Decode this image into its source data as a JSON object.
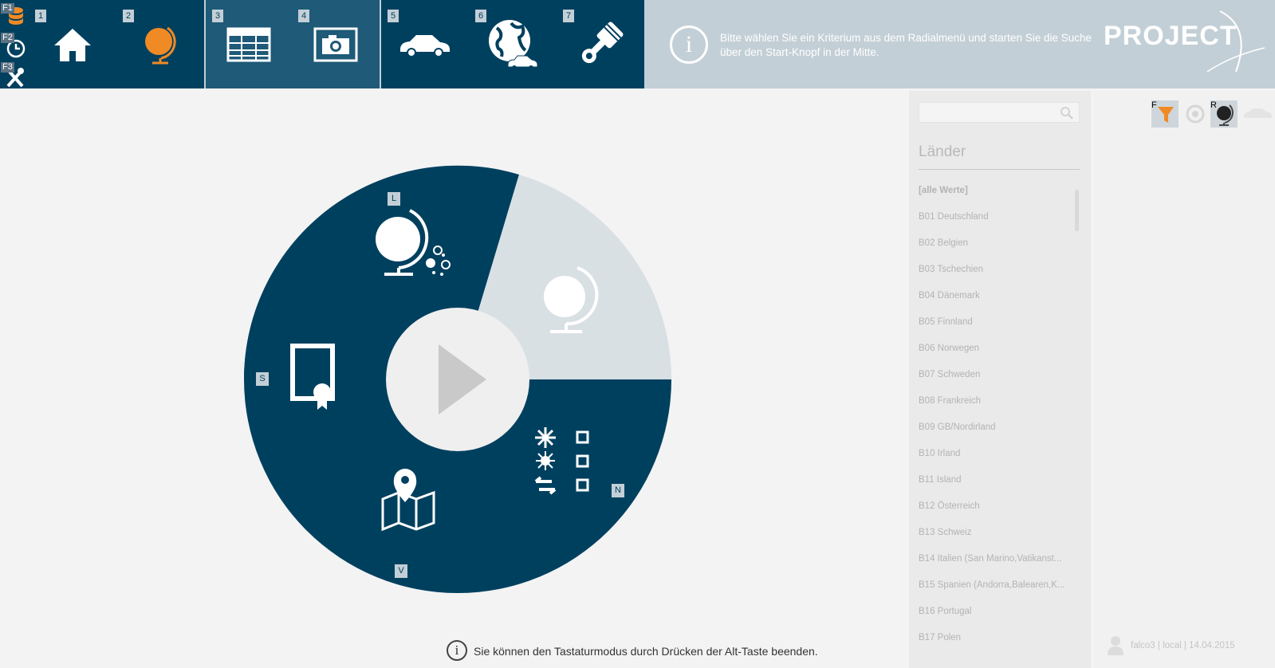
{
  "fkeys": [
    {
      "label": "F1",
      "icon": "database-icon"
    },
    {
      "label": "F2",
      "icon": "history-icon"
    },
    {
      "label": "F3",
      "icon": "tools-icon"
    }
  ],
  "tiles": [
    {
      "num": "1",
      "icon": "home-icon"
    },
    {
      "num": "2",
      "icon": "globe-icon"
    },
    {
      "num": "3",
      "icon": "table-icon"
    },
    {
      "num": "4",
      "icon": "camera-icon"
    },
    {
      "num": "5",
      "icon": "car-icon"
    },
    {
      "num": "6",
      "icon": "earth-car-icon"
    },
    {
      "num": "7",
      "icon": "piston-icon"
    }
  ],
  "info": {
    "message": "Bitte wählen Sie ein Kriterium aus dem Radialmenü und starten Sie die Suche über den Start-Knopf in der Mitte.",
    "logo": "PROJECT"
  },
  "radial": {
    "keys": {
      "L": "L",
      "S": "S",
      "N": "N",
      "V": "V"
    },
    "colors": {
      "segment": "#00405f",
      "disabled": "#d9e0e4",
      "center": "#efefef",
      "play": "#c9c9c9"
    }
  },
  "hint": {
    "text": "Sie können den Tastaturmodus durch Drücken der Alt-Taste beenden."
  },
  "filter": {
    "search_placeholder": "",
    "title": "Länder",
    "items": [
      "[alle Werte]",
      "B01 Deutschland",
      "B02 Belgien",
      "B03 Tschechien",
      "B04 Dänemark",
      "B05 Finnland",
      "B06 Norwegen",
      "B07 Schweden",
      "B08 Frankreich",
      "B09 GB/Nordirland",
      "B10 Irland",
      "B11 Island",
      "B12 Österreich",
      "B13 Schweiz",
      "B14 Italien (San Marino,Vatikanst...",
      "B15 Spanien (Andorra,Balearen,K...",
      "B16 Portugal",
      "B17 Polen"
    ]
  },
  "side": {
    "icons": [
      {
        "key": "F",
        "icon": "filter-icon"
      },
      {
        "key": "",
        "icon": "eye-icon"
      },
      {
        "key": "R",
        "icon": "globe-reset-icon"
      },
      {
        "key": "",
        "icon": "car-outline-icon"
      }
    ],
    "status": "falco3 | local | 14.04.2015"
  },
  "colors": {
    "brand": "#00405f",
    "accent": "#f08a24",
    "topbar_bg": "#c3cfd6"
  }
}
